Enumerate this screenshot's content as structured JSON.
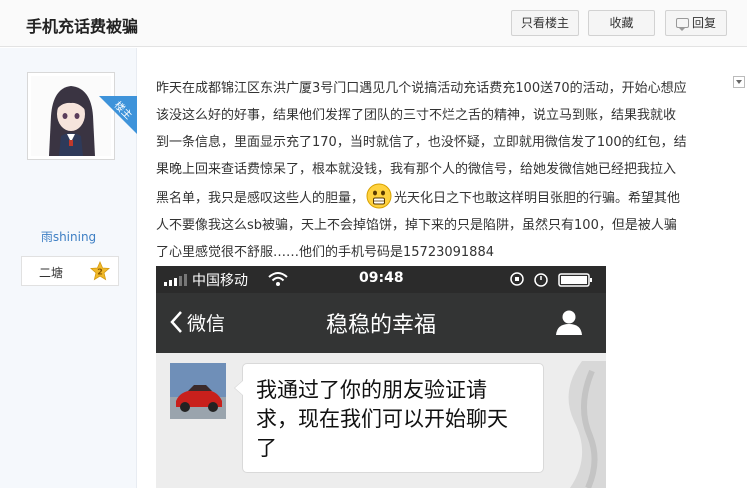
{
  "header": {
    "title": "手机充话费被骗",
    "only_author_label": "只看楼主",
    "favorite_label": "收藏",
    "reply_label": "回复"
  },
  "user": {
    "floor_tag": "楼主",
    "name": "雨shining",
    "rank_label": "二塘",
    "rank_level": "2"
  },
  "post": {
    "lines": [
      "昨天在成都锦江区东洪广厦3号门口遇见几个说搞活动充话费充100送70的活动，开始心想应",
      "该没这么好的好事，结果他们发挥了团队的三寸不烂之舌的精神，说立马到账，结果我就收",
      "到一条信息，里面显示充了170，当时就信了，也没怀疑，立即就用微信发了100的红包，结",
      "果晚上回来查话费惊呆了，根本就没钱，我有那个人的微信号，给她发微信她已经把我拉入",
      "黑名单，我只是感叹这些人的胆量，",
      "光天化日之下也敢这样明目张胆的行骗。希望其他",
      "人不要像我这么sb被骗，天上不会掉馅饼，掉下来的只是陷阱，虽然只有100，但是被人骗",
      "了心里感觉很不舒服……他们的手机号码是15723091884"
    ],
    "emoji_icon": "surprised-face-emoji"
  },
  "screenshot": {
    "carrier": "中国移动",
    "time": "09:48",
    "back_label": "微信",
    "chat_title": "稳稳的幸福",
    "message_lines": [
      "我通过了你的朋友验证请",
      "求，现在我们可以开始聊天",
      "了"
    ]
  },
  "colors": {
    "accent_blue": "#3e93da",
    "username_blue": "#3e7fc4",
    "wechat_bar": "#333434",
    "status_bar": "#2b2b2b"
  }
}
